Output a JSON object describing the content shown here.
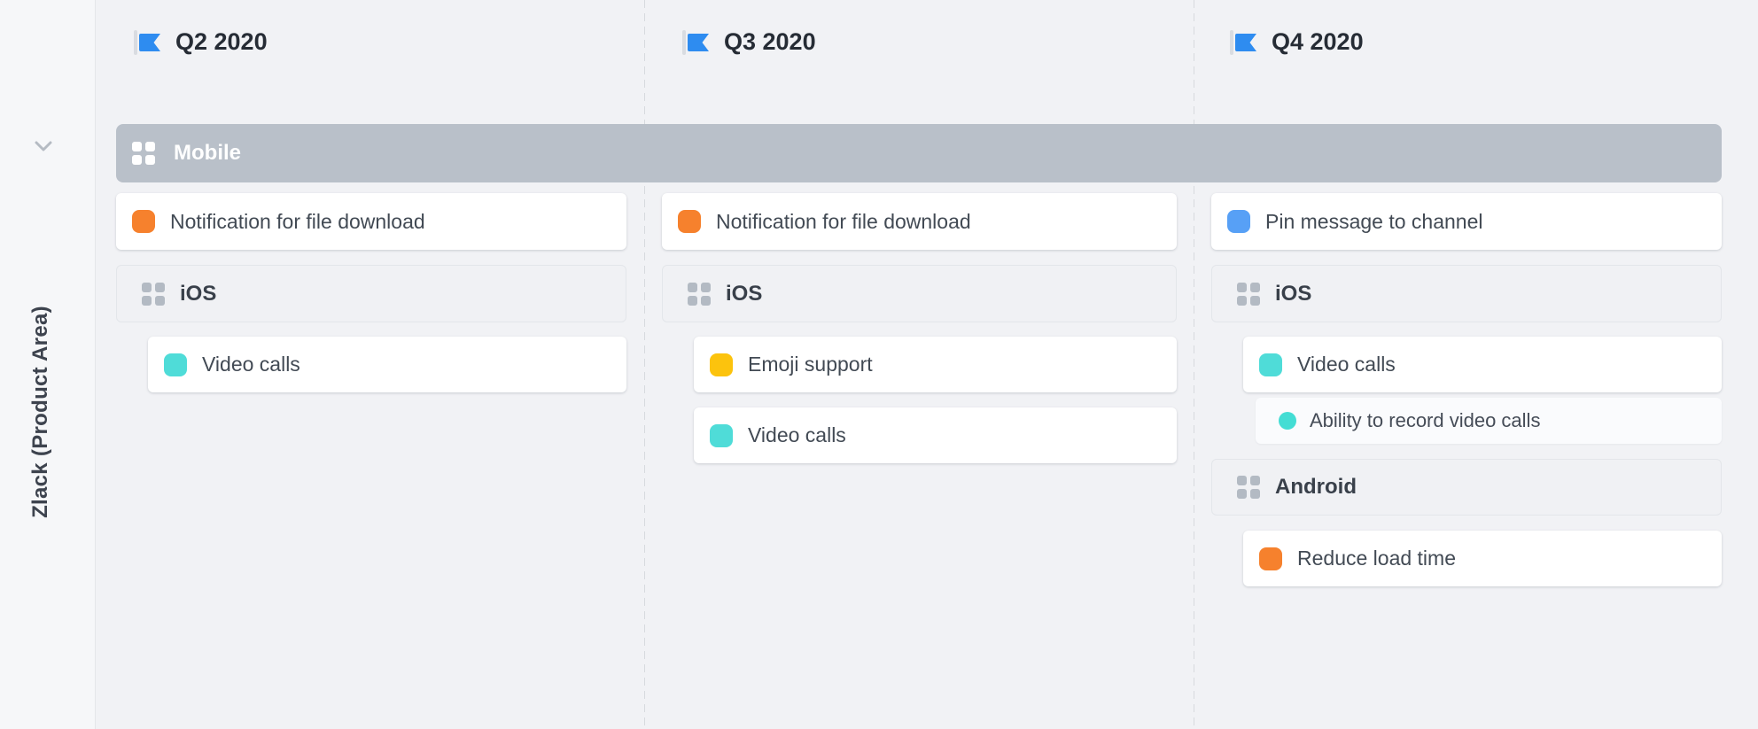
{
  "sidebar": {
    "row_label": "Zlack (Product Area)"
  },
  "quarters": [
    {
      "label": "Q2 2020"
    },
    {
      "label": "Q3 2020"
    },
    {
      "label": "Q4 2020"
    }
  ],
  "group_bar": {
    "label": "Mobile"
  },
  "colors": {
    "flag_blue": "#2e8cf0",
    "group_bar_gray": "#b9c0c9",
    "orange": "#f6812d",
    "yellow": "#fcc30d",
    "teal": "#4fdcd8",
    "teal_dot": "#43ddd4",
    "blue": "#57a0f6"
  },
  "columns": [
    {
      "quarter": "Q2 2020",
      "cards": [
        {
          "title": "Notification for file download",
          "color": "#f6812d"
        },
        {
          "subgroup": "iOS"
        },
        {
          "title": "Video calls",
          "color": "#4fdcd8"
        }
      ]
    },
    {
      "quarter": "Q3 2020",
      "cards": [
        {
          "title": "Notification for file download",
          "color": "#f6812d"
        },
        {
          "subgroup": "iOS"
        },
        {
          "title": "Emoji support",
          "color": "#fcc30d"
        },
        {
          "title": "Video calls",
          "color": "#4fdcd8"
        }
      ]
    },
    {
      "quarter": "Q4 2020",
      "cards": [
        {
          "title": "Pin message to channel",
          "color": "#57a0f6"
        },
        {
          "subgroup": "iOS"
        },
        {
          "title": "Video calls",
          "color": "#4fdcd8"
        },
        {
          "title": "Ability to record video calls",
          "color": "#43ddd4"
        },
        {
          "subgroup": "Android"
        },
        {
          "title": "Reduce load time",
          "color": "#f6812d"
        }
      ]
    }
  ]
}
